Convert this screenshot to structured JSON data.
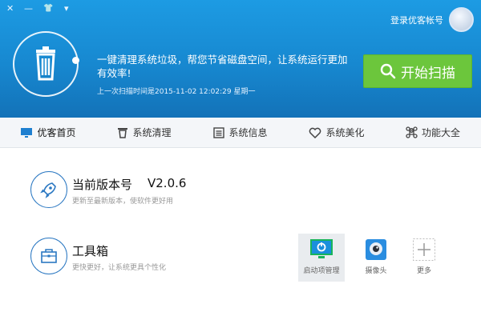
{
  "window": {
    "close_glyph": "✕",
    "minimize_glyph": "—",
    "skin_glyph": "👕",
    "menu_glyph": "▾"
  },
  "header": {
    "login_text": "登录优客帐号",
    "slogan": "一键清理系统垃圾，帮您节省磁盘空间，让系统运行更加有效率!",
    "last_scan": "上一次扫描时间是2015-11-02 12:02:29 星期一",
    "scan_button": "开始扫描"
  },
  "nav": {
    "items": [
      {
        "label": "优客首页",
        "icon": "monitor-icon"
      },
      {
        "label": "系统清理",
        "icon": "trash-icon"
      },
      {
        "label": "系统信息",
        "icon": "list-icon"
      },
      {
        "label": "系统美化",
        "icon": "heart-icon"
      },
      {
        "label": "功能大全",
        "icon": "command-icon"
      }
    ]
  },
  "version": {
    "title": "当前版本号",
    "value": "V2.0.6",
    "subtitle": "更新至最新版本，使软件更好用"
  },
  "tools": {
    "title": "工具箱",
    "subtitle": "更快更好，让系统更具个性化",
    "items": [
      {
        "label": "启动项管理",
        "icon": "startup-icon"
      },
      {
        "label": "摄像头",
        "icon": "camera-icon"
      },
      {
        "label": "更多",
        "icon": "plus-icon"
      }
    ]
  },
  "colors": {
    "header_blue": "#1788d0",
    "scan_green": "#6cc63c",
    "accent_blue": "#2b78c2"
  }
}
